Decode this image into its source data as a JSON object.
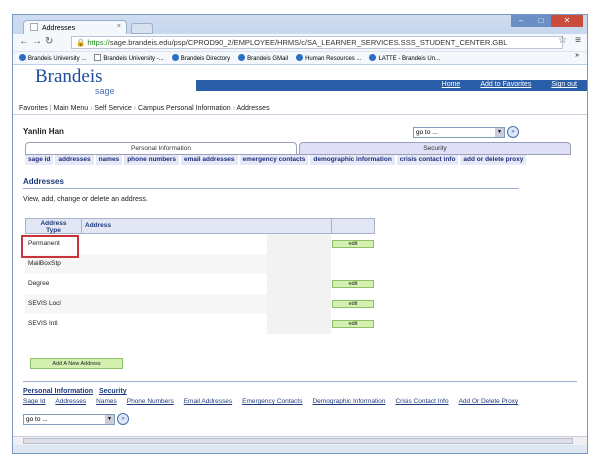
{
  "browser": {
    "tab_title": "Addresses",
    "tab_close": "×",
    "url_scheme": "https://",
    "url_rest": "sage.brandeis.edu/psp/CPROD90_2/EMPLOYEE/HRMS/c/SA_LEARNER_SERVICES.SSS_STUDENT_CENTER.GBL",
    "bookmarks": [
      {
        "label": "Brandeis University ...",
        "icon": "globe-icon"
      },
      {
        "label": "Brandeis University -...",
        "icon": "page-icon"
      },
      {
        "label": "Brandeis Directory",
        "icon": "globe-icon"
      },
      {
        "label": "Brandeis GMail",
        "icon": "globe-icon"
      },
      {
        "label": "Human Resources ...",
        "icon": "globe-icon"
      },
      {
        "label": "LATTE - Brandeis Un...",
        "icon": "globe-icon"
      }
    ],
    "bookmarks_more": "»"
  },
  "header": {
    "logo_main": "Brandeis",
    "logo_sub": "sage",
    "links": [
      "Home",
      "Add to Favorites",
      "Sign out"
    ]
  },
  "breadcrumb": [
    "Favorites",
    "Main Menu",
    "Self Service",
    "Campus Personal Information",
    "Addresses"
  ],
  "user": {
    "name": "Yanlin Han"
  },
  "goto": {
    "label": "go to ..."
  },
  "tabs": {
    "personal": "Personal Information",
    "security": "Security"
  },
  "subnav": [
    "sage id",
    "addresses",
    "names",
    "phone numbers",
    "email addresses",
    "emergency contacts",
    "demographic information",
    "crisis contact info",
    "add or delete proxy"
  ],
  "section": {
    "title": "Addresses",
    "intro": "View, add, change or delete an address."
  },
  "grid": {
    "col_type_line1": "Address",
    "col_type_line2": "Type",
    "col_address": "Address",
    "edit_label": "edit",
    "rows": [
      {
        "type": "Permanent",
        "editable": true
      },
      {
        "type": "MailBoxStp",
        "editable": false
      },
      {
        "type": "Degree",
        "editable": true
      },
      {
        "type": "SEVIS Locl",
        "editable": true
      },
      {
        "type": "SEVIS Intl",
        "editable": true
      }
    ]
  },
  "add_button": "Add A New Address",
  "footer": {
    "primary": [
      "Personal Information",
      "Security"
    ],
    "links": [
      "Sage Id",
      "Addresses",
      "Names",
      "Phone Numbers",
      "Email Addresses",
      "Emergency Contacts",
      "Demographic Information",
      "Crisis Contact Info",
      "Add Or Delete Proxy"
    ]
  }
}
